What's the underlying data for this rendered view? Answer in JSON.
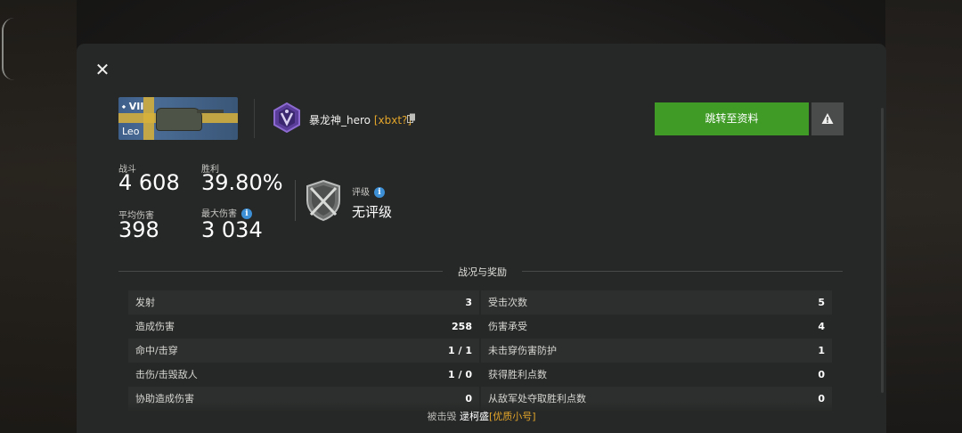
{
  "dialog": {
    "close_icon": "close-icon",
    "tank": {
      "tier": "VII",
      "name": "Leo"
    },
    "player": {
      "name": "暴龙神_hero",
      "clan_tag": "[xbxt?]"
    },
    "goto_button_label": "跳转至资料",
    "report_icon": "warning-icon",
    "stats": {
      "battles_label": "战斗",
      "battles_value": "4 608",
      "winrate_label": "胜利",
      "winrate_value": "39.80%",
      "avg_damage_label": "平均伤害",
      "avg_damage_value": "398",
      "max_damage_label": "最大伤害",
      "max_damage_value": "3 034"
    },
    "rating": {
      "label": "评级",
      "value": "无评级"
    },
    "section_title": "战况与奖励",
    "rows": [
      {
        "left_label": "发射",
        "left_value": "3",
        "right_label": "受击次数",
        "right_value": "5"
      },
      {
        "left_label": "造成伤害",
        "left_value": "258",
        "right_label": "伤害承受",
        "right_value": "4"
      },
      {
        "left_label": "命中/击穿",
        "left_value": "1 / 1",
        "right_label": "未击穿伤害防护",
        "right_value": "1"
      },
      {
        "left_label": "击伤/击毁敌人",
        "left_value": "1 / 0",
        "right_label": "获得胜利点数",
        "right_value": "0"
      },
      {
        "left_label": "协助造成伤害",
        "left_value": "0",
        "right_label": "从敌军处夺取胜利点数",
        "right_value": "0"
      }
    ],
    "footer": {
      "prefix": "被击毁",
      "killer_name": "逯柯盛",
      "killer_tag": "[优质小号]"
    }
  },
  "colors": {
    "accent_green": "#3f9b26",
    "clan_tag": "#e3a52a",
    "info_blue": "#3d8fd6",
    "panel_bg": "#262827"
  }
}
